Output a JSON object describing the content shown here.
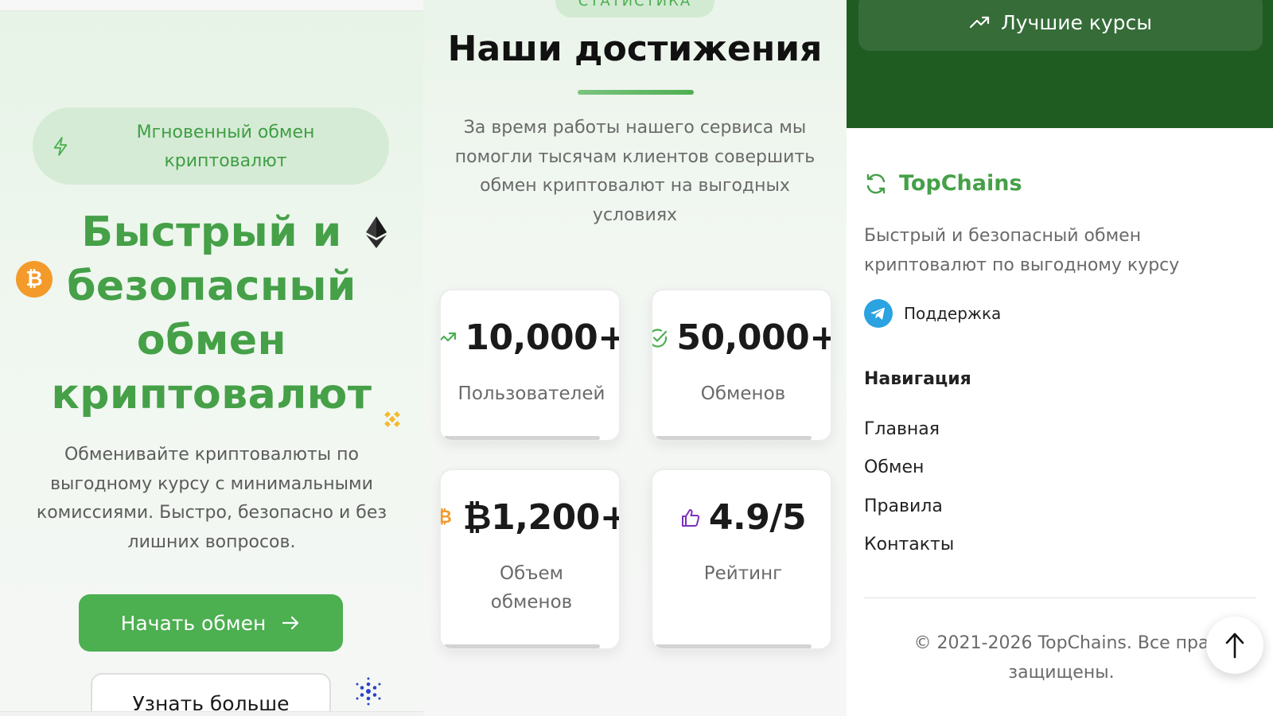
{
  "hero": {
    "badge": "Мгновенный обмен криптовалют",
    "title_lines": [
      "Быстрый и",
      "безопасный",
      "обмен",
      "криптовалют"
    ],
    "description": "Обменивайте криптовалюты по выгодному курсу с минимальными комиссиями. Быстро, безопасно и без лишних вопросов.",
    "start_button": "Начать обмен",
    "more_button": "Узнать больше",
    "btc_symbol": "₿"
  },
  "stats": {
    "chip": "СТАТИСТИКА",
    "title": "Наши достижения",
    "description": "За время работы нашего сервиса мы помогли тысячам клиентов совершить обмен криптовалют на выгодных условиях",
    "cards": [
      {
        "value": "10,000+",
        "label": "Пользователей",
        "icon": "trending-up-icon",
        "icon_color": "#4caf50"
      },
      {
        "value": "50,000+",
        "label": "Обменов",
        "icon": "check-circle-icon",
        "icon_color": "#4caf50"
      },
      {
        "value": "₿1,200+",
        "label": "Объем обменов",
        "icon": "bitcoin-icon",
        "icon_color": "#f39a2b"
      },
      {
        "value": "4.9/5",
        "label": "Рейтинг",
        "icon": "thumbs-up-icon",
        "icon_color": "#7b2fbe"
      }
    ]
  },
  "footer": {
    "best_rates_button": "Лучшие курсы",
    "brand_name": "TopChains",
    "brand_description": "Быстрый и безопасный обмен криптовалют по выгодному курсу",
    "support_label": "Поддержка",
    "nav_heading": "Навигация",
    "nav_items": [
      "Главная",
      "Обмен",
      "Правила",
      "Контакты"
    ],
    "copyright_line1": "© 2021-2026 TopChains. Все пра",
    "copyright_line2": "защищены."
  },
  "colors": {
    "brand_green": "#4caf50",
    "dark_green": "#1f5c22",
    "telegram_blue": "#2aa3e0"
  }
}
